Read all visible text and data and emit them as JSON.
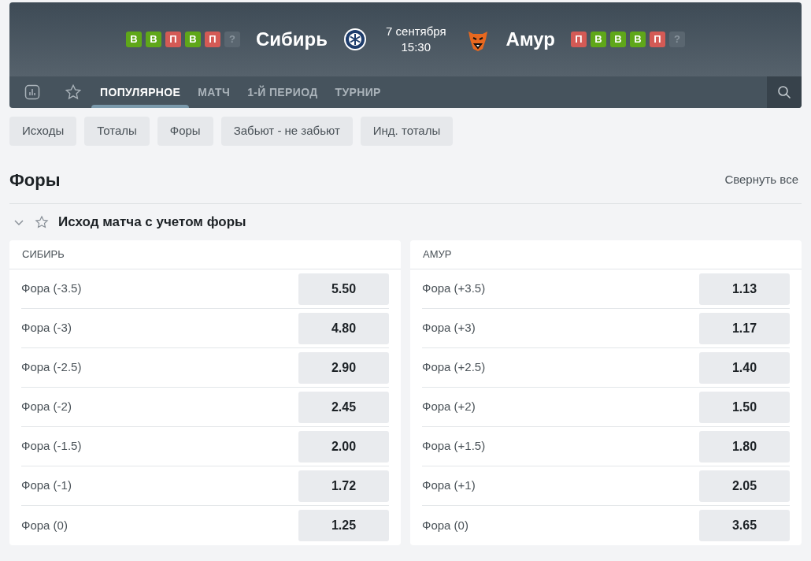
{
  "match": {
    "home": {
      "name": "Сибирь",
      "form": [
        {
          "kind": "win",
          "label": "В"
        },
        {
          "kind": "win",
          "label": "В"
        },
        {
          "kind": "loss",
          "label": "П"
        },
        {
          "kind": "win",
          "label": "В"
        },
        {
          "kind": "loss",
          "label": "П"
        },
        {
          "kind": "unknown",
          "label": "?"
        }
      ]
    },
    "date": "7 сентября",
    "time": "15:30",
    "away": {
      "name": "Амур",
      "form": [
        {
          "kind": "loss",
          "label": "П"
        },
        {
          "kind": "win",
          "label": "В"
        },
        {
          "kind": "win",
          "label": "В"
        },
        {
          "kind": "win",
          "label": "В"
        },
        {
          "kind": "loss",
          "label": "П"
        },
        {
          "kind": "unknown",
          "label": "?"
        }
      ]
    }
  },
  "tabs": [
    {
      "label": "ПОПУЛЯРНОЕ",
      "selected": true
    },
    {
      "label": "МАТЧ",
      "selected": false
    },
    {
      "label": "1-Й ПЕРИОД",
      "selected": false
    },
    {
      "label": "ТУРНИР",
      "selected": false
    }
  ],
  "filters": [
    "Исходы",
    "Тоталы",
    "Форы",
    "Забьют - не забьют",
    "Инд. тоталы"
  ],
  "section": {
    "title": "Форы",
    "collapse_all": "Свернуть все"
  },
  "market": {
    "title": "Исход матча с учетом форы",
    "expanded": true,
    "columns": [
      {
        "team": "СИБИРЬ",
        "rows": [
          {
            "label": "Фора (-3.5)",
            "odds": "5.50"
          },
          {
            "label": "Фора (-3)",
            "odds": "4.80"
          },
          {
            "label": "Фора (-2.5)",
            "odds": "2.90"
          },
          {
            "label": "Фора (-2)",
            "odds": "2.45"
          },
          {
            "label": "Фора (-1.5)",
            "odds": "2.00"
          },
          {
            "label": "Фора (-1)",
            "odds": "1.72"
          },
          {
            "label": "Фора (0)",
            "odds": "1.25"
          }
        ]
      },
      {
        "team": "АМУР",
        "rows": [
          {
            "label": "Фора (+3.5)",
            "odds": "1.13"
          },
          {
            "label": "Фора (+3)",
            "odds": "1.17"
          },
          {
            "label": "Фора (+2.5)",
            "odds": "1.40"
          },
          {
            "label": "Фора (+2)",
            "odds": "1.50"
          },
          {
            "label": "Фора (+1.5)",
            "odds": "1.80"
          },
          {
            "label": "Фора (+1)",
            "odds": "2.05"
          },
          {
            "label": "Фора (0)",
            "odds": "3.65"
          }
        ]
      }
    ]
  }
}
